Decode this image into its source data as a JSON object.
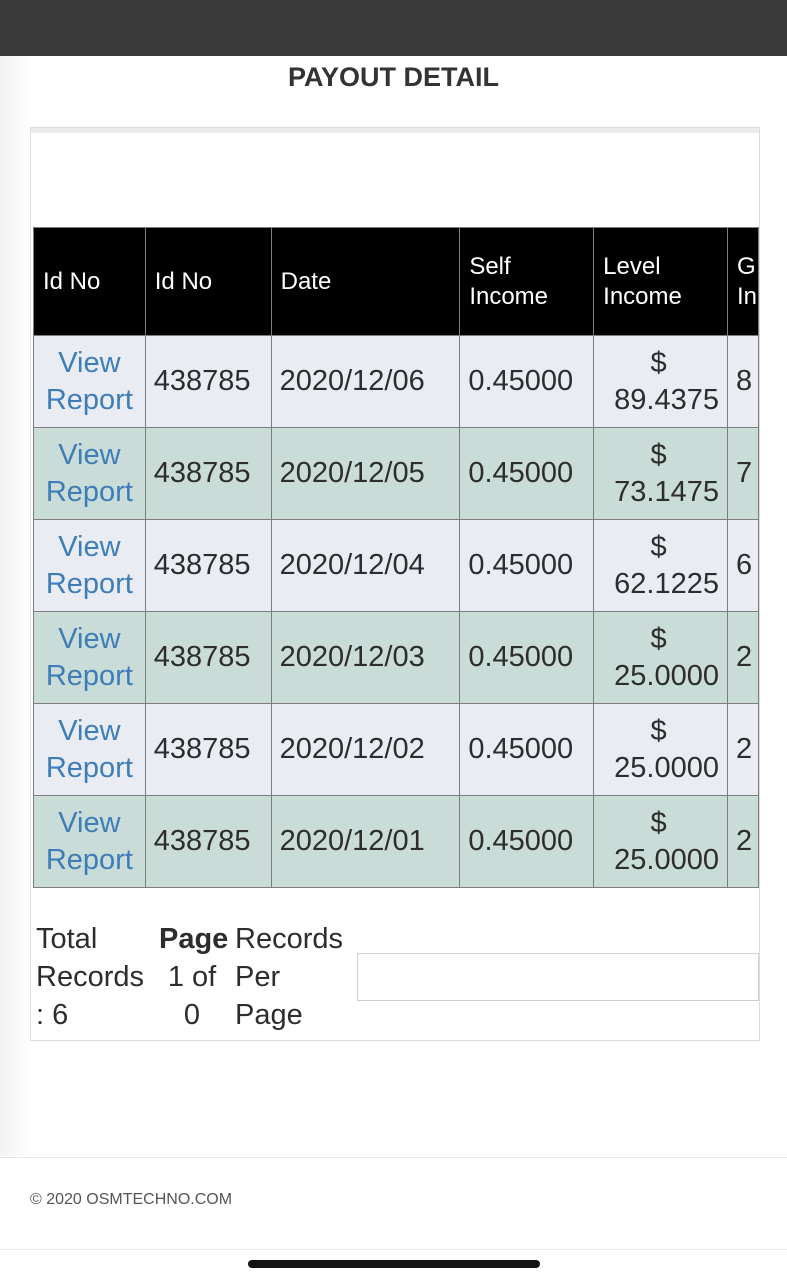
{
  "page": {
    "title": "PAYOUT DETAIL"
  },
  "table": {
    "headers": [
      "Id No",
      "Id No",
      "Date",
      "Self Income",
      "Level Income",
      "G In"
    ],
    "rows": [
      {
        "link": "View Report",
        "id": "438785",
        "date": "2020/12/06",
        "self": "0.45000",
        "level": "89.4375",
        "extra": "8"
      },
      {
        "link": "View Report",
        "id": "438785",
        "date": "2020/12/05",
        "self": "0.45000",
        "level": "73.1475",
        "extra": "7"
      },
      {
        "link": "View Report",
        "id": "438785",
        "date": "2020/12/04",
        "self": "0.45000",
        "level": "62.1225",
        "extra": "6"
      },
      {
        "link": "View Report",
        "id": "438785",
        "date": "2020/12/03",
        "self": "0.45000",
        "level": "25.0000",
        "extra": "2"
      },
      {
        "link": "View Report",
        "id": "438785",
        "date": "2020/12/02",
        "self": "0.45000",
        "level": "25.0000",
        "extra": "2"
      },
      {
        "link": "View Report",
        "id": "438785",
        "date": "2020/12/01",
        "self": "0.45000",
        "level": "25.0000",
        "extra": "2"
      }
    ],
    "currency_symbol": "$"
  },
  "footer": {
    "total_records": "Total Records : 6",
    "page_label": "Page",
    "page_value": "1 of 0",
    "records_per_page": "Records Per Page",
    "records_per_page_value": ""
  },
  "copyright": "© 2020 OSMTECHNO.COM",
  "colors": {
    "header_bg": "#000000",
    "row_odd": "#e9edf3",
    "row_even": "#c9dcd7",
    "link": "#3d7db8"
  }
}
